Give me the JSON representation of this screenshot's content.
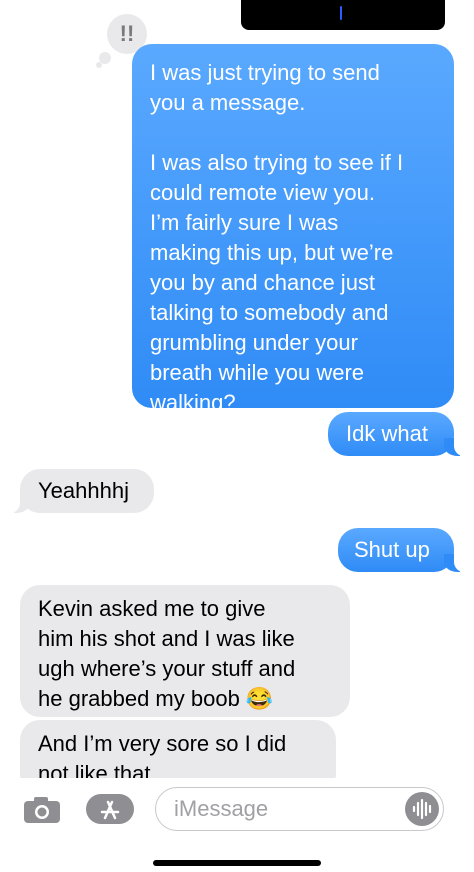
{
  "messages": [
    {
      "direction": "sent",
      "text": "I was just trying to send\nyou a message.\n\nI was also trying to see if I\ncould remote view you.\nI’m fairly sure I was\nmaking this up, but we’re\nyou by and chance just\ntalking to somebody and\ngrumbling under your\nbreath while you were\nwalking?",
      "tapback": "!!"
    },
    {
      "direction": "sent",
      "text": "Idk what"
    },
    {
      "direction": "received",
      "text": "Yeahhhhj"
    },
    {
      "direction": "sent",
      "text": "Shut up"
    },
    {
      "direction": "received",
      "text": "Kevin asked me to give\nhim his shot and I was like\nugh where’s your stuff and\nhe grabbed my boob 😂"
    },
    {
      "direction": "received",
      "text": "And I’m very sore so I did\nnot like that"
    }
  ],
  "composer": {
    "placeholder": "iMessage",
    "icons": [
      "camera-icon",
      "app-store-icon",
      "audio-waveform-icon"
    ]
  },
  "colors": {
    "sent_bubble": "#2f8bf6",
    "received_bubble": "#e9e9eb",
    "background": "#ffffff"
  }
}
